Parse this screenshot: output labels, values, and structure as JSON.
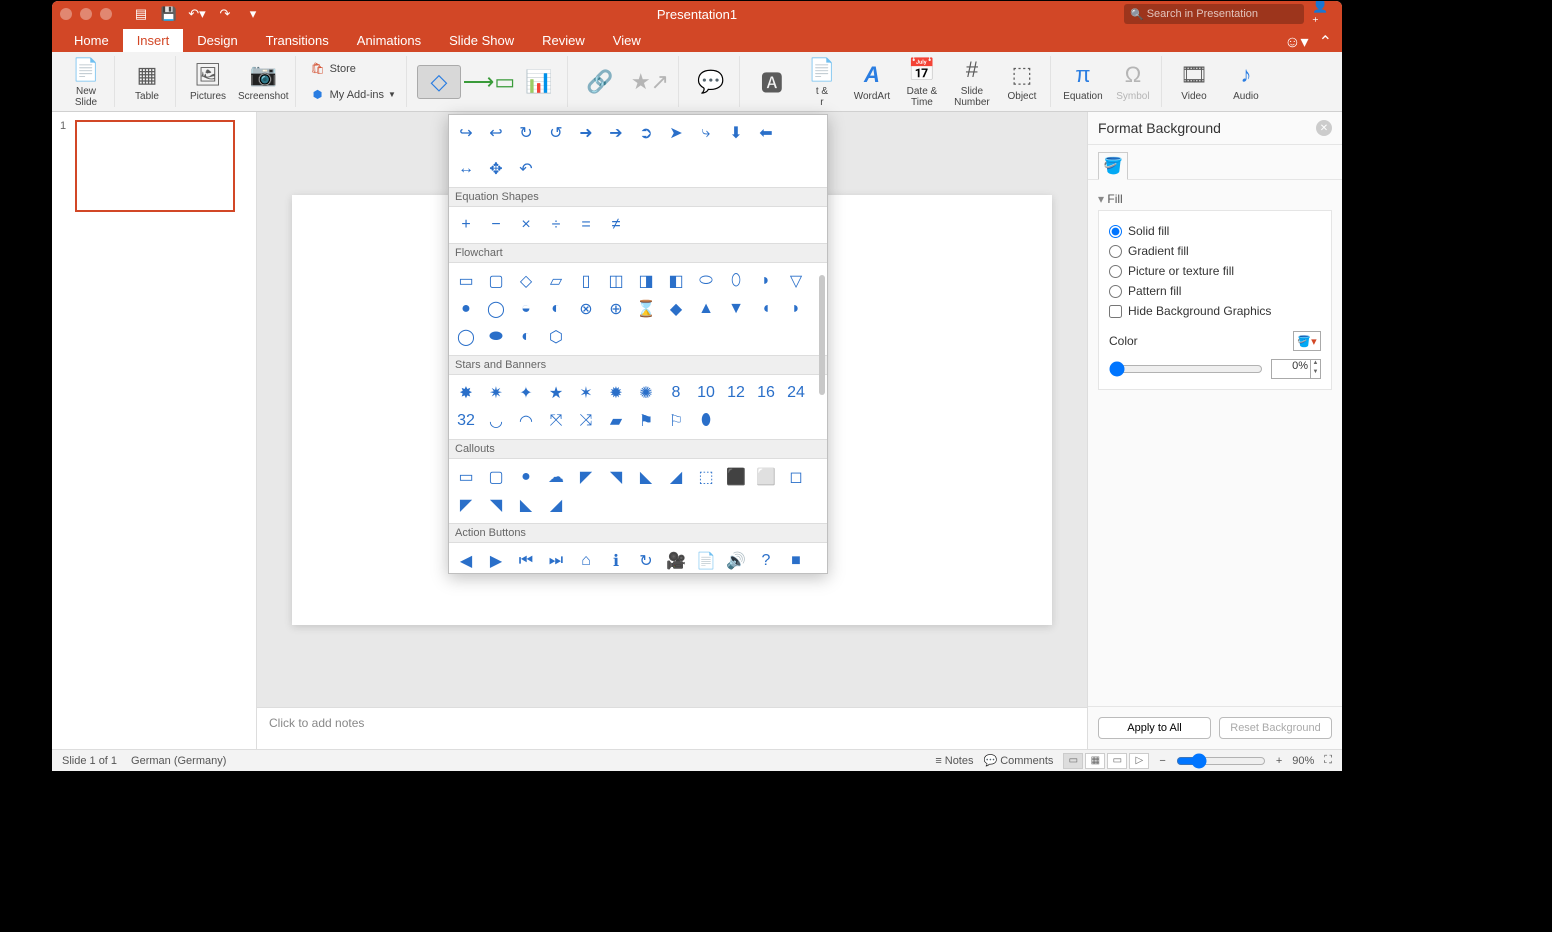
{
  "title": "Presentation1",
  "search_placeholder": "Search in Presentation",
  "tabs": [
    "Home",
    "Insert",
    "Design",
    "Transitions",
    "Animations",
    "Slide Show",
    "Review",
    "View"
  ],
  "active_tab": "Insert",
  "ribbon": {
    "new_slide": "New\nSlide",
    "table": "Table",
    "pictures": "Pictures",
    "screenshot": "Screenshot",
    "store": "Store",
    "my_addins": "My Add-ins",
    "wordart": "WordArt",
    "date_time": "Date &\nTime",
    "slide_number": "Slide\nNumber",
    "object": "Object",
    "equation": "Equation",
    "symbol": "Symbol",
    "video": "Video",
    "audio": "Audio",
    "hf_partial": "t &\nr"
  },
  "thumb_number": "1",
  "notes_placeholder": "Click to add notes",
  "shapes_dropdown": {
    "arrows_extra": [
      "↪",
      "↩",
      "↻",
      "↺",
      "➜",
      "➔",
      "➲",
      "➤",
      "⤷",
      "⬇",
      "⬅"
    ],
    "arrows_row2": [
      "↔",
      "✥",
      "↶"
    ],
    "cat_eq": "Equation Shapes",
    "eq": [
      "+",
      "−",
      "×",
      "÷",
      "=",
      "≠"
    ],
    "cat_flow": "Flowchart",
    "flow": [
      "▭",
      "▢",
      "◇",
      "▱",
      "▯",
      "◫",
      "◨",
      "◧",
      "⬭",
      "⬯",
      "◗",
      "▽",
      "●",
      "◯",
      "◒",
      "◐",
      "⊗",
      "⊕",
      "⌛",
      "◆",
      "▲",
      "▼",
      "◖",
      "◗",
      "◯",
      "⬬",
      "◐",
      "⬡"
    ],
    "cat_stars": "Stars and Banners",
    "stars": [
      "✸",
      "✷",
      "✦",
      "★",
      "✶",
      "✹",
      "✺",
      "8",
      "10",
      "12",
      "16",
      "24",
      "32",
      "◡",
      "◠",
      "⤧",
      "⤨",
      "▰",
      "⚑",
      "⚐",
      "⬮"
    ],
    "cat_call": "Callouts",
    "call": [
      "▭",
      "▢",
      "●",
      "☁",
      "◤",
      "◥",
      "◣",
      "◢",
      "⬚",
      "⬛",
      "⬜",
      "◻",
      "◤",
      "◥",
      "◣",
      "◢"
    ],
    "cat_action": "Action Buttons",
    "action": [
      "◀",
      "▶",
      "⏮",
      "⏭",
      "⌂",
      "ℹ",
      "↻",
      "🎥",
      "📄",
      "🔊",
      "?",
      "■"
    ]
  },
  "format_pane": {
    "title": "Format Background",
    "section": "Fill",
    "solid": "Solid fill",
    "gradient": "Gradient fill",
    "picture": "Picture or texture fill",
    "pattern": "Pattern fill",
    "hide_bg": "Hide Background Graphics",
    "color": "Color",
    "transparency_pct": "0%",
    "apply_all": "Apply to All",
    "reset": "Reset Background"
  },
  "statusbar": {
    "slide_info": "Slide 1 of 1",
    "lang": "German (Germany)",
    "notes": "Notes",
    "comments": "Comments",
    "zoom": "90%"
  }
}
